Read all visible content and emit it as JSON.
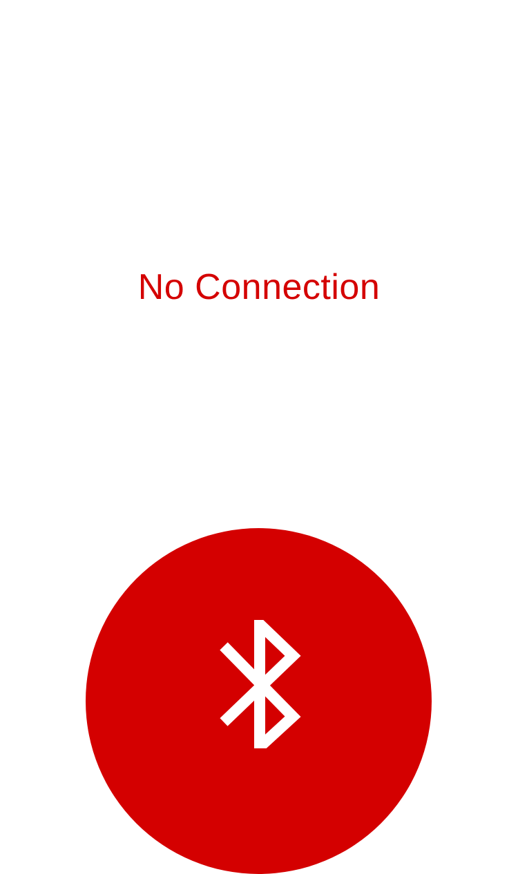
{
  "status": {
    "text": "No Connection",
    "color": "#d40000"
  },
  "connect_button": {
    "icon": "bluetooth-icon",
    "color": "#d40000",
    "icon_color": "#ffffff"
  }
}
